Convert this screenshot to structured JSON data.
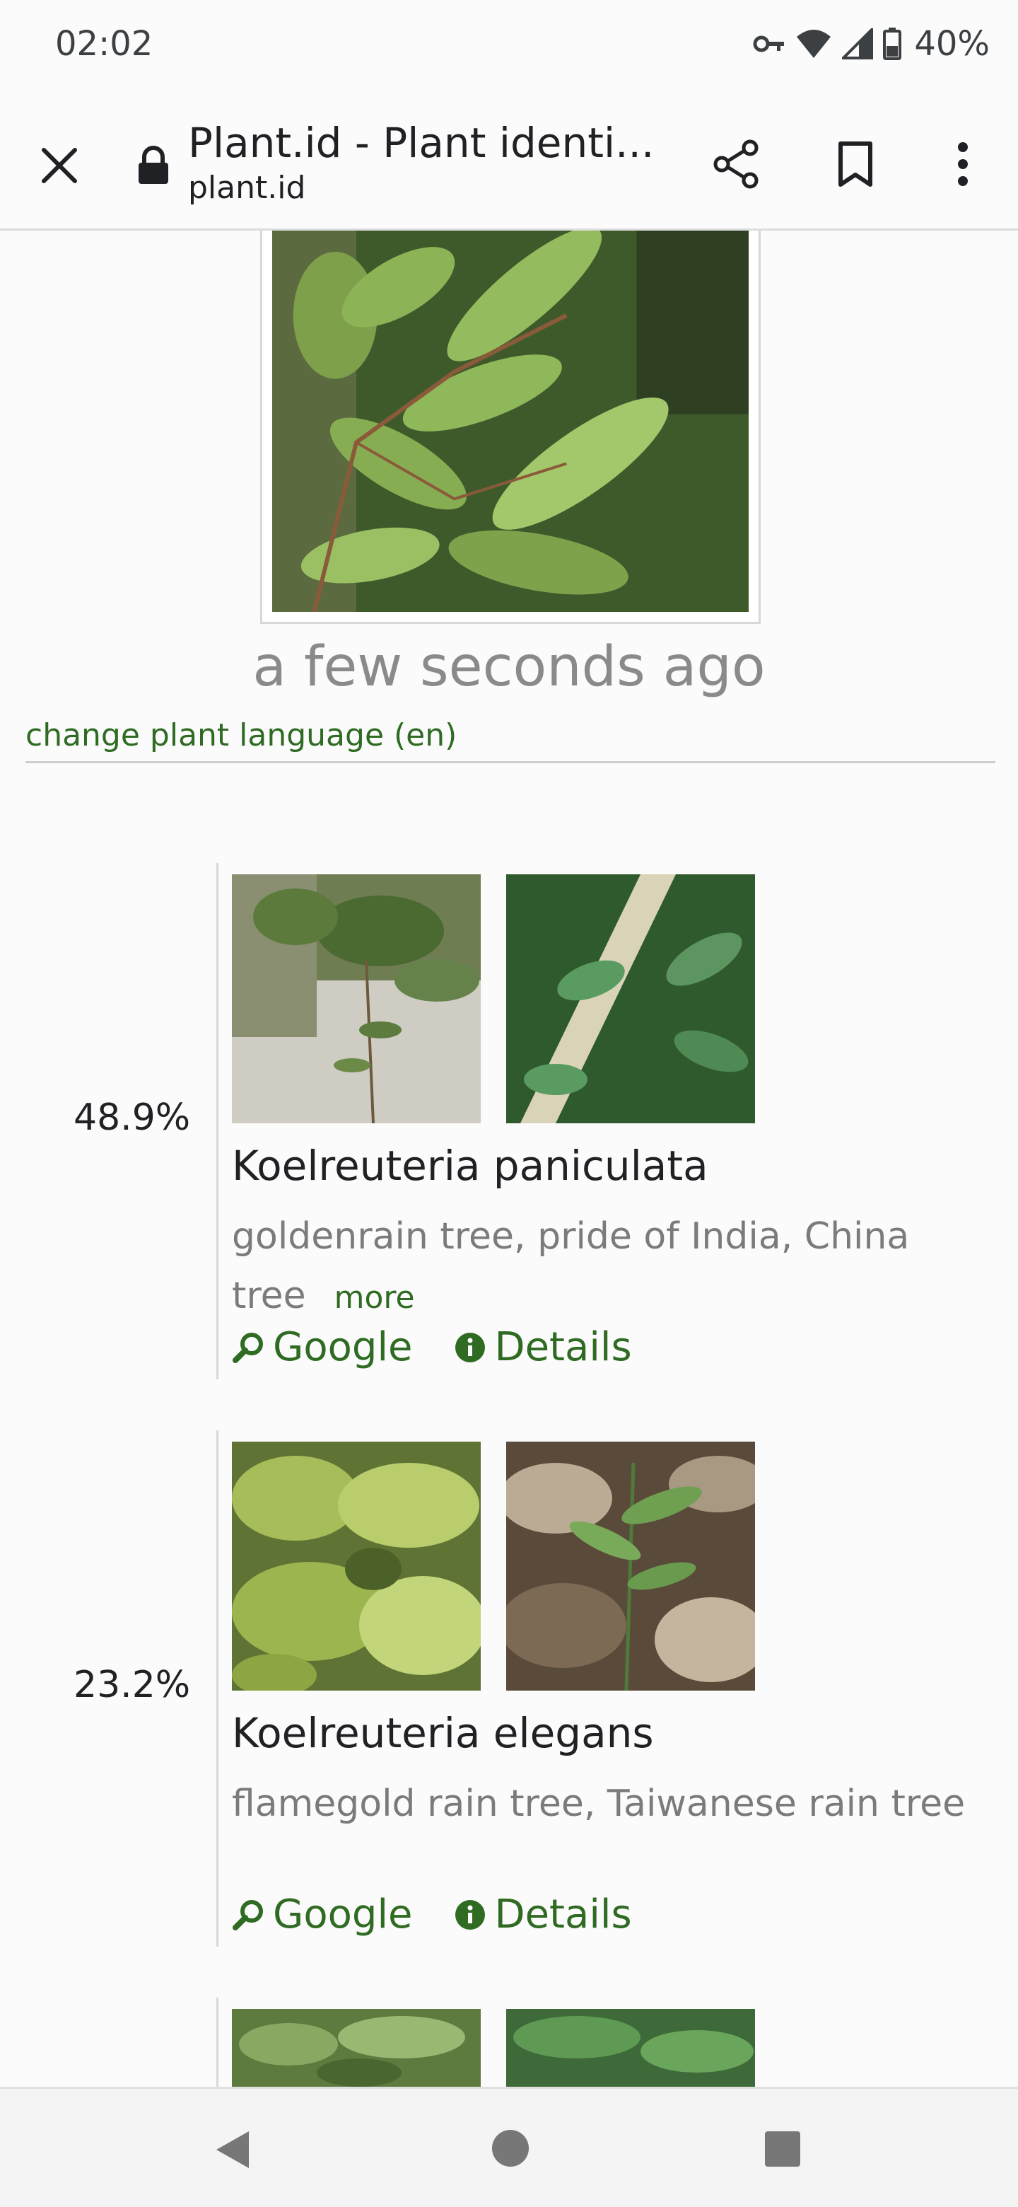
{
  "status_bar": {
    "time": "02:02",
    "battery": "40%"
  },
  "browser": {
    "page_title": "Plant.id - Plant identi...",
    "url": "plant.id"
  },
  "main": {
    "timestamp": "a few seconds ago",
    "language_link": "change plant language (en)"
  },
  "results": [
    {
      "probability": "48.9%",
      "scientific_name": "Koelreuteria paniculata",
      "common_names": "goldenrain tree, pride of India, China tree",
      "more_label": "more",
      "google_label": "Google",
      "details_label": "Details"
    },
    {
      "probability": "23.2%",
      "scientific_name": "Koelreuteria elegans",
      "common_names": "flamegold rain tree, Taiwanese rain tree",
      "google_label": "Google",
      "details_label": "Details"
    }
  ],
  "colors": {
    "link_green": "#2f6b22",
    "muted_text": "#7b7b7b",
    "background": "#fbfbfb"
  }
}
